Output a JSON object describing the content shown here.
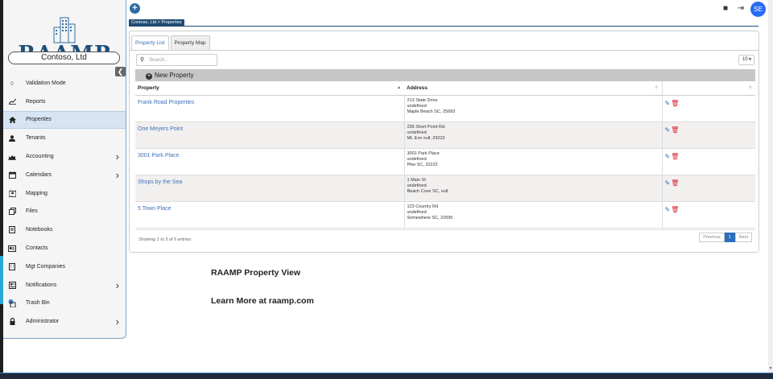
{
  "app": {
    "logo_text": "RAAMP",
    "company": "Contoso, Ltd",
    "breadcrumb": "Contoso, Ltd > Properties"
  },
  "sidebar": {
    "items": [
      {
        "label": "Validation Mode",
        "icon": "circle-outline-icon",
        "arrow": false
      },
      {
        "label": "Reports",
        "icon": "line-chart-icon",
        "arrow": false
      },
      {
        "label": "Properties",
        "icon": "home-icon",
        "arrow": false,
        "active": true
      },
      {
        "label": "Tenants",
        "icon": "user-icon",
        "arrow": false
      },
      {
        "label": "Accounting",
        "icon": "area-chart-icon",
        "arrow": true
      },
      {
        "label": "Calendars",
        "icon": "calendar-icon",
        "arrow": true
      },
      {
        "label": "Mapping",
        "icon": "map-icon",
        "arrow": false
      },
      {
        "label": "Files",
        "icon": "files-icon",
        "arrow": false
      },
      {
        "label": "Notebooks",
        "icon": "notebook-icon",
        "arrow": false
      },
      {
        "label": "Contacts",
        "icon": "address-card-icon",
        "arrow": false
      },
      {
        "label": "Mgt Companies",
        "icon": "building-icon",
        "arrow": false
      },
      {
        "label": "Notifications",
        "icon": "newspaper-icon",
        "arrow": true
      },
      {
        "label": "Trash Bin",
        "icon": "trash-bin-icon",
        "arrow": false
      },
      {
        "label": "Administrator",
        "icon": "lock-icon",
        "arrow": true
      }
    ],
    "collapse_glyph": "❮"
  },
  "topbar": {
    "add_glyph": "+",
    "bookmark_glyph": "■",
    "logout_glyph": "⇥",
    "avatar_initials": "SE"
  },
  "tabs": [
    {
      "label": "Property List",
      "active": true
    },
    {
      "label": "Property Map",
      "active": false
    }
  ],
  "search": {
    "placeholder": "Search..."
  },
  "page_size": "10",
  "new_property_label": "New Property",
  "table": {
    "columns": [
      "Property",
      "Address",
      ""
    ],
    "rows": [
      {
        "property": "Frank Road Properties",
        "addr1": "213 State Drive",
        "addr2": "undefined",
        "addr3": "Maple Beach SC, 25693"
      },
      {
        "property": "One Meyers Point",
        "addr1": "236 Short Point Rd.",
        "addr2": "undefined",
        "addr3": "Mt. Eve null, 29222"
      },
      {
        "property": "3001 Park Place",
        "addr1": "3001 Park Place",
        "addr2": "undefined",
        "addr3": "Pike  SC, 32222"
      },
      {
        "property": "Shops by the Sea",
        "addr1": "1 Main St",
        "addr2": "undefined",
        "addr3": "Beach Cove SC, null"
      },
      {
        "property": "5 Town Place",
        "addr1": "123 Country Rd",
        "addr2": "undefined",
        "addr3": "Somewhere SC, 22695"
      }
    ]
  },
  "pagination": {
    "showing": "Showing 1 to 5 of 5 entries",
    "previous": "Previous",
    "current": "1",
    "next": "Next"
  },
  "captions": {
    "line1": "RAAMP Property View",
    "line2": "Learn More at raamp.com"
  },
  "colors": {
    "brand": "#1d4f7a",
    "link": "#3b73b9",
    "avatar": "#2a6cf5",
    "active_nav": "#d6e4f3"
  }
}
